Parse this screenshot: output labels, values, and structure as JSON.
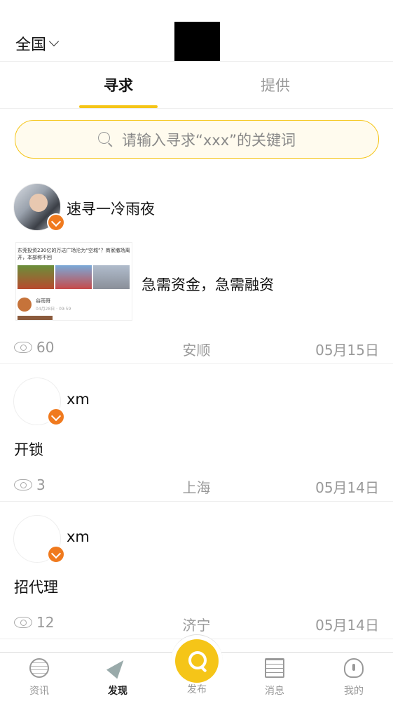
{
  "header": {
    "region": "全国"
  },
  "tabs": [
    {
      "label": "寻求",
      "active": true
    },
    {
      "label": "提供",
      "active": false
    }
  ],
  "search": {
    "placeholder": "请输入寻求“xxx”的关键词"
  },
  "posts": [
    {
      "username": "速寻一冷雨夜",
      "content": "急需资金，急需融资",
      "views": "60",
      "city": "安顺",
      "date": "05月15日",
      "thumbnail": {
        "headline": "东莞投资230亿的万达广场沦为“空城”？商家撤场离",
        "headline2": "开，本部称不回",
        "author": "谷雨哥",
        "date": "04月28日 · 09:59"
      }
    },
    {
      "username": "xm",
      "content": "开锁",
      "views": "3",
      "city": "上海",
      "date": "05月14日"
    },
    {
      "username": "xm",
      "content": "招代理",
      "views": "12",
      "city": "济宁",
      "date": "05月14日"
    }
  ],
  "bottom_nav": [
    {
      "label": "资讯",
      "icon": "globe-icon",
      "active": false
    },
    {
      "label": "发现",
      "icon": "rocket-icon",
      "active": true
    },
    {
      "label": "发布",
      "icon": "search-icon",
      "active": false
    },
    {
      "label": "消息",
      "icon": "chat-icon",
      "active": false
    },
    {
      "label": "我的",
      "icon": "bulb-icon",
      "active": false
    }
  ],
  "colors": {
    "accent": "#f5c518",
    "badge": "#f07a1e"
  }
}
